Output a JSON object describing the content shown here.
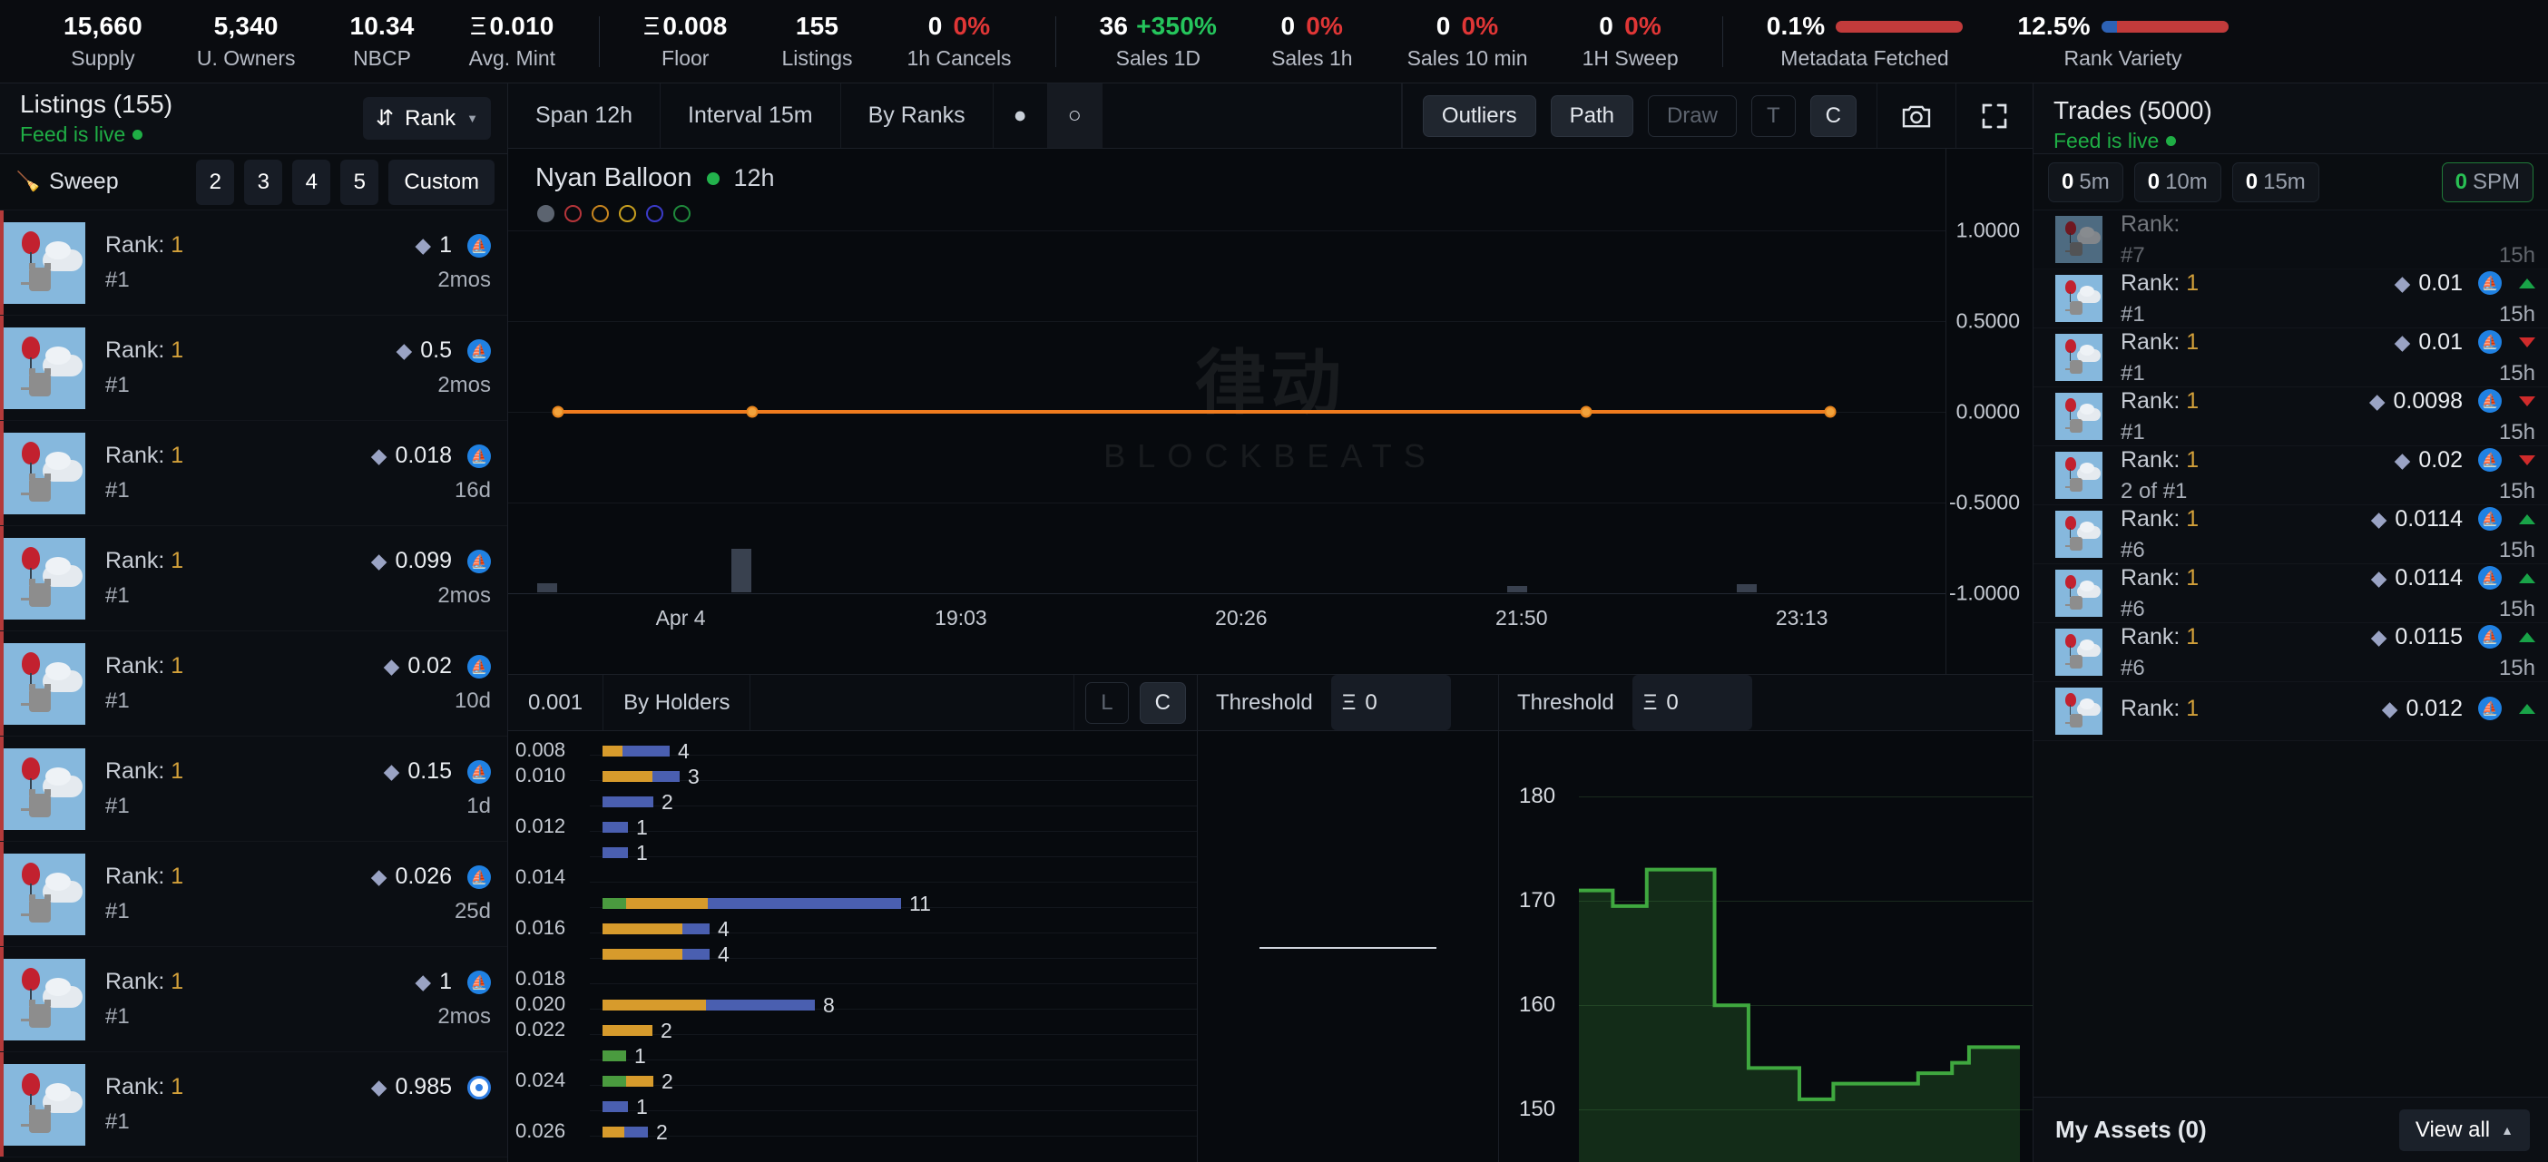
{
  "stats": [
    {
      "value": "15,660",
      "label": "Supply",
      "eth": false
    },
    {
      "value": "5,340",
      "label": "U. Owners",
      "eth": false
    },
    {
      "value": "10.34",
      "label": "NBCP",
      "eth": false
    },
    {
      "value": "0.010",
      "label": "Avg. Mint",
      "eth": true
    },
    {
      "value": "0.008",
      "label": "Floor",
      "eth": true
    },
    {
      "value": "155",
      "label": "Listings",
      "eth": false
    },
    {
      "value": "0",
      "label": "1h Cancels",
      "eth": false,
      "pct": "0%",
      "pct_dir": "flat"
    },
    {
      "value": "36",
      "label": "Sales 1D",
      "eth": false,
      "pct": "+350%",
      "pct_dir": "up"
    },
    {
      "value": "0",
      "label": "Sales 1h",
      "eth": false,
      "pct": "0%",
      "pct_dir": "flat"
    },
    {
      "value": "0",
      "label": "Sales 10 min",
      "eth": false,
      "pct": "0%",
      "pct_dir": "flat"
    },
    {
      "value": "0",
      "label": "1H Sweep",
      "eth": false,
      "pct": "0%",
      "pct_dir": "flat"
    }
  ],
  "meters": [
    {
      "value": "0.1%",
      "label": "Metadata Fetched",
      "blue_pct": 0,
      "red_pct": 100
    },
    {
      "value": "12.5%",
      "label": "Rank Variety",
      "blue_pct": 12.5,
      "red_pct": 87.5
    }
  ],
  "listings_panel": {
    "title": "Listings (155)",
    "live_text": "Feed is live",
    "sort_label": "Rank",
    "sort_icon": "sort-desc-icon",
    "sweep_label": "Sweep",
    "sweep_options": [
      "2",
      "3",
      "4",
      "5"
    ],
    "sweep_custom": "Custom",
    "rows": [
      {
        "rank_label": "Rank:",
        "rank": "1",
        "id": "#1",
        "price": "1",
        "age": "2mos",
        "market": "opensea"
      },
      {
        "rank_label": "Rank:",
        "rank": "1",
        "id": "#1",
        "price": "0.5",
        "age": "2mos",
        "market": "opensea"
      },
      {
        "rank_label": "Rank:",
        "rank": "1",
        "id": "#1",
        "price": "0.018",
        "age": "16d",
        "market": "opensea"
      },
      {
        "rank_label": "Rank:",
        "rank": "1",
        "id": "#1",
        "price": "0.099",
        "age": "2mos",
        "market": "opensea"
      },
      {
        "rank_label": "Rank:",
        "rank": "1",
        "id": "#1",
        "price": "0.02",
        "age": "10d",
        "market": "opensea"
      },
      {
        "rank_label": "Rank:",
        "rank": "1",
        "id": "#1",
        "price": "0.15",
        "age": "1d",
        "market": "opensea"
      },
      {
        "rank_label": "Rank:",
        "rank": "1",
        "id": "#1",
        "price": "0.026",
        "age": "25d",
        "market": "opensea"
      },
      {
        "rank_label": "Rank:",
        "rank": "1",
        "id": "#1",
        "price": "1",
        "age": "2mos",
        "market": "opensea"
      },
      {
        "rank_label": "Rank:",
        "rank": "1",
        "id": "#1",
        "price": "0.985",
        "age": "",
        "market": "blur"
      }
    ]
  },
  "chart_toolbar": {
    "span": "Span 12h",
    "interval": "Interval 15m",
    "by": "By Ranks",
    "dot_filled": "●",
    "dot_hollow": "○",
    "outliers": "Outliers",
    "path": "Path",
    "draw": "Draw",
    "t": "T",
    "c": "C",
    "camera_icon": "camera-icon",
    "expand_icon": "expand-icon"
  },
  "chart_data": {
    "type": "line",
    "title": "Nyan Balloon",
    "subtitle": "12h",
    "status_dot_color": "#22b24c",
    "legend_dots": [
      "#5c6470",
      "#b6353a",
      "#c9861f",
      "#c9a01f",
      "#3b3bc9",
      "#1f8a3c"
    ],
    "ylabel": "",
    "xlabel": "",
    "yticks": [
      "1.0000",
      "0.5000",
      "0.0000",
      "-0.5000",
      "-1.0000"
    ],
    "ylim": [
      -1.0,
      1.0
    ],
    "xticks": [
      "Apr 4",
      "19:03",
      "20:26",
      "21:50",
      "23:13"
    ],
    "series": [
      {
        "name": "price",
        "color": "#f07c1f",
        "points": [
          {
            "x": 0.035,
            "y": 0.0
          },
          {
            "x": 0.17,
            "y": 0.0
          },
          {
            "x": 0.75,
            "y": 0.0
          },
          {
            "x": 0.92,
            "y": 0.0
          }
        ]
      }
    ],
    "volume_bars": [
      {
        "x": 0.02,
        "h": 10
      },
      {
        "x": 0.155,
        "h": 48
      },
      {
        "x": 0.695,
        "h": 7
      },
      {
        "x": 0.855,
        "h": 9
      }
    ],
    "watermark_main": "律动",
    "watermark_sub": "BLOCKBEATS"
  },
  "depth_panel": {
    "tick": "0.001",
    "mode": "By Holders",
    "btn_l": "L",
    "btn_c": "C",
    "threshold_label": "Threshold",
    "threshold_value": "0",
    "threshold_icon": "eth-icon",
    "chart_data": {
      "type": "bar",
      "orientation": "horizontal",
      "categories": [
        "0.008",
        "0.010",
        "0.012",
        "0.014",
        "0.016",
        "0.018",
        "0.020",
        "0.022",
        "0.024",
        "0.026"
      ],
      "bars": [
        {
          "price": "0.008",
          "count": "4",
          "green": 0,
          "orange": 22,
          "blue": 52
        },
        {
          "price": "0.010",
          "count": "3",
          "green": 0,
          "orange": 55,
          "blue": 30
        },
        {
          "price": "",
          "count": "2",
          "green": 0,
          "orange": 0,
          "blue": 56
        },
        {
          "price": "0.012",
          "count": "1",
          "green": 0,
          "orange": 0,
          "blue": 28
        },
        {
          "price": "",
          "count": "1",
          "green": 0,
          "orange": 0,
          "blue": 28
        },
        {
          "price": "0.014",
          "count": "",
          "green": 0,
          "orange": 0,
          "blue": 0
        },
        {
          "price": "",
          "count": "11",
          "green": 26,
          "orange": 90,
          "blue": 213
        },
        {
          "price": "0.016",
          "count": "4",
          "green": 0,
          "orange": 88,
          "blue": 30
        },
        {
          "price": "",
          "count": "4",
          "green": 0,
          "orange": 88,
          "blue": 30
        },
        {
          "price": "0.018",
          "count": "",
          "green": 0,
          "orange": 0,
          "blue": 0
        },
        {
          "price": "0.020",
          "count": "8",
          "green": 0,
          "orange": 114,
          "blue": 120
        },
        {
          "price": "0.022",
          "count": "2",
          "green": 0,
          "orange": 55,
          "blue": 0
        },
        {
          "price": "",
          "count": "1",
          "green": 26,
          "orange": 0,
          "blue": 0
        },
        {
          "price": "0.024",
          "count": "2",
          "green": 26,
          "orange": 30,
          "blue": 0
        },
        {
          "price": "",
          "count": "1",
          "green": 0,
          "orange": 0,
          "blue": 28
        },
        {
          "price": "0.026",
          "count": "2",
          "green": 0,
          "orange": 24,
          "blue": 26
        }
      ]
    }
  },
  "second_threshold": {
    "label": "Threshold",
    "value": "0",
    "icon": "eth-icon"
  },
  "holders_chart": {
    "chart_data": {
      "type": "area",
      "title": "",
      "color": "#3fa83f",
      "yticks": [
        "180",
        "170",
        "160",
        "150"
      ],
      "ylim": [
        145,
        184
      ],
      "values": [
        171,
        171,
        169.5,
        169.5,
        173,
        173,
        173,
        173,
        160,
        160,
        154,
        154,
        154,
        151,
        151,
        152.5,
        152.5,
        152.5,
        152.5,
        152.5,
        153.5,
        153.5,
        154.5,
        156,
        156,
        156,
        156
      ]
    }
  },
  "trades_panel": {
    "title": "Trades (5000)",
    "live_text": "Feed is live",
    "pills": [
      {
        "count": "0",
        "label": "5m"
      },
      {
        "count": "0",
        "label": "10m"
      },
      {
        "count": "0",
        "label": "15m"
      }
    ],
    "spm": {
      "count": "0",
      "label": "SPM"
    },
    "rows": [
      {
        "rank_label": "Rank:",
        "rank": "",
        "id": "#7",
        "price": "",
        "age": "15h",
        "market": "",
        "dir": "none",
        "partial": true
      },
      {
        "rank_label": "Rank:",
        "rank": "1",
        "id": "#1",
        "price": "0.01",
        "age": "15h",
        "market": "opensea",
        "dir": "up"
      },
      {
        "rank_label": "Rank:",
        "rank": "1",
        "id": "#1",
        "price": "0.01",
        "age": "15h",
        "market": "opensea",
        "dir": "down"
      },
      {
        "rank_label": "Rank:",
        "rank": "1",
        "id": "#1",
        "price": "0.0098",
        "age": "15h",
        "market": "opensea",
        "dir": "down"
      },
      {
        "rank_label": "Rank:",
        "rank": "1",
        "id": "2 of #1",
        "price": "0.02",
        "age": "15h",
        "market": "opensea",
        "dir": "down"
      },
      {
        "rank_label": "Rank:",
        "rank": "1",
        "id": "#6",
        "price": "0.0114",
        "age": "15h",
        "market": "opensea",
        "dir": "up"
      },
      {
        "rank_label": "Rank:",
        "rank": "1",
        "id": "#6",
        "price": "0.0114",
        "age": "15h",
        "market": "opensea",
        "dir": "up"
      },
      {
        "rank_label": "Rank:",
        "rank": "1",
        "id": "#6",
        "price": "0.0115",
        "age": "15h",
        "market": "opensea",
        "dir": "up"
      },
      {
        "rank_label": "Rank:",
        "rank": "1",
        "id": "",
        "price": "0.012",
        "age": "",
        "market": "opensea",
        "dir": "up"
      }
    ],
    "assets_label": "My Assets (0)",
    "view_all": "View all"
  },
  "colors": {
    "accent_orange": "#f07c1f",
    "green": "#22b24c",
    "red": "#cf2b2b",
    "blue": "#4a5fb0",
    "gold": "#d79b2c",
    "bg": "#07090c"
  }
}
